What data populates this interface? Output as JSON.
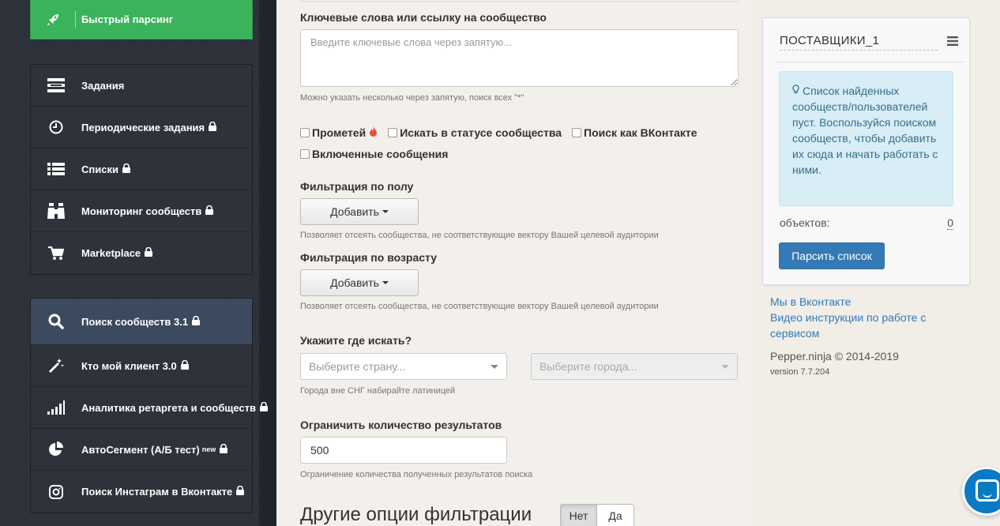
{
  "sidebar": {
    "quick_parse": "Быстрый парсинг",
    "group1": [
      {
        "label": "Задания",
        "icon": "tasks-icon",
        "locked": false
      },
      {
        "label": "Периодические задания",
        "icon": "clock-icon",
        "locked": true
      },
      {
        "label": "Списки",
        "icon": "list-icon",
        "locked": true
      },
      {
        "label": "Мониторинг сообществ",
        "icon": "binoculars-icon",
        "locked": true
      },
      {
        "label": "Marketplace",
        "icon": "cart-icon",
        "locked": true
      }
    ],
    "group2": [
      {
        "label": "Поиск сообществ 3.1",
        "icon": "search-icon",
        "locked": true
      },
      {
        "label": "Кто мой клиент 3.0",
        "icon": "magic-wand-icon",
        "locked": true
      },
      {
        "label": "Аналитика ретаргета и сообществ",
        "icon": "signal-bars-icon",
        "locked": true
      },
      {
        "label": "АвтоСегмент (А/Б тест)",
        "sup": "new",
        "icon": "pie-chart-icon",
        "locked": true
      },
      {
        "label": "Поиск Инстаграм в Вконтакте",
        "icon": "instagram-icon",
        "locked": true
      }
    ]
  },
  "form": {
    "keywords_label": "Ключевые слова или ссылку на сообщество",
    "keywords_placeholder": "Введите ключевые слова через запятую...",
    "keywords_help": "Можно указать несколько через запятую, поиск всех \"*\"",
    "checkbox_prometheus": "Прометей",
    "checkbox_status": "Искать в статусе сообщества",
    "checkbox_vk": "Поиск как ВКонтакте",
    "checkbox_messages": "Включенные сообщения",
    "gender_label": "Фильтрация по полу",
    "add_label": "Добавить",
    "gender_help": "Позволяет отсеять сообщества, не соответствующие вектору Вашей целевой аудитории",
    "age_label": "Фильтрация по возрасту",
    "age_help": "Позволяет отсеять сообщества, не соответствующие вектору Вашей целевой аудитории",
    "where_label": "Укажите где искать?",
    "country_placeholder": "Выберите страну...",
    "city_placeholder": "Выберите города...",
    "where_help": "Города вне СНГ набирайте латиницей",
    "limit_label": "Ограничить количество результатов",
    "limit_value": "500",
    "limit_help": "Ограничение количества полученных результатов поиска",
    "other_options": "Другие опции фильтрации",
    "toggle_no": "Нет",
    "toggle_yes": "Да"
  },
  "panel": {
    "title": "ПОСТАВЩИКИ_1",
    "alert": "Список найденных сообществ/пользователей пуст. Воспользуйся поиском сообществ, чтобы добавить их сюда и начать работать с ними.",
    "objects_label": "объектов:",
    "objects_count": "0",
    "parse_button": "Парсить список"
  },
  "footer": {
    "vk_link": "Мы в Вконтакте",
    "video_link": "Видео инструкции по работе с сервисом",
    "copyright": "Pepper.ninja © 2014-2019",
    "version": "version 7.7.204"
  },
  "colors": {
    "accent_green": "#3bb35a",
    "primary_blue": "#337ab7",
    "sidebar_bg": "#2c3039"
  }
}
